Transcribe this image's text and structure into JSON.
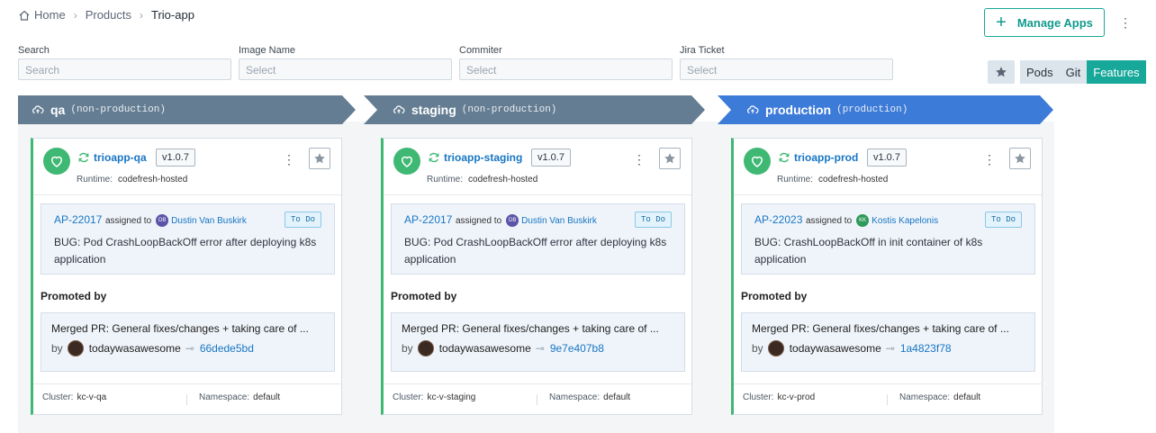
{
  "breadcrumb": {
    "home": "Home",
    "products": "Products",
    "current": "Trio-app"
  },
  "actions": {
    "manage_apps": "Manage Apps"
  },
  "filters": [
    {
      "label": "Search",
      "placeholder": "Search"
    },
    {
      "label": "Image Name",
      "placeholder": "Select"
    },
    {
      "label": "Commiter",
      "placeholder": "Select"
    },
    {
      "label": "Jira Ticket",
      "placeholder": "Select"
    }
  ],
  "view_toggle": {
    "pods": "Pods",
    "git": "Git",
    "features": "Features",
    "active": "Features"
  },
  "colors": {
    "accent": "#17a89a",
    "env_default": "#647d92",
    "env_production": "#3d7bd8",
    "health": "#3fb874",
    "link": "#1876c4"
  },
  "environments": [
    {
      "name": "qa",
      "type": "(non-production)",
      "app": "trioapp-qa",
      "version": "v1.0.7",
      "runtime_label": "Runtime:",
      "runtime": "codefresh-hosted",
      "jira": {
        "id": "AP-22017",
        "assigned_label": "assigned to",
        "initials": "DB",
        "assignee": "Dustin Van Buskirk",
        "status": "To Do",
        "title": "BUG: Pod CrashLoopBackOff error after deploying k8s application"
      },
      "promoted_label": "Promoted by",
      "pr": {
        "title": "Merged PR: General fixes/changes + taking care of ...",
        "by": "by",
        "user": "todaywasawesome",
        "sha": "66dede5bd"
      },
      "cluster_label": "Cluster:",
      "cluster": "kc-v-qa",
      "namespace_label": "Namespace:",
      "namespace": "default"
    },
    {
      "name": "staging",
      "type": "(non-production)",
      "app": "trioapp-staging",
      "version": "v1.0.7",
      "runtime_label": "Runtime:",
      "runtime": "codefresh-hosted",
      "jira": {
        "id": "AP-22017",
        "assigned_label": "assigned to",
        "initials": "DB",
        "assignee": "Dustin Van Buskirk",
        "status": "To Do",
        "title": "BUG: Pod CrashLoopBackOff error after deploying k8s application"
      },
      "promoted_label": "Promoted by",
      "pr": {
        "title": "Merged PR: General fixes/changes + taking care of ...",
        "by": "by",
        "user": "todaywasawesome",
        "sha": "9e7e407b8"
      },
      "cluster_label": "Cluster:",
      "cluster": "kc-v-staging",
      "namespace_label": "Namespace:",
      "namespace": "default"
    },
    {
      "name": "production",
      "type": "(production)",
      "app": "trioapp-prod",
      "version": "v1.0.7",
      "runtime_label": "Runtime:",
      "runtime": "codefresh-hosted",
      "jira": {
        "id": "AP-22023",
        "assigned_label": "assigned to",
        "initials": "KK",
        "assignee": "Kostis Kapelonis",
        "status": "To Do",
        "title": "BUG: CrashLoopBackOff in init container of k8s application"
      },
      "promoted_label": "Promoted by",
      "pr": {
        "title": "Merged PR: General fixes/changes + taking care of ...",
        "by": "by",
        "user": "todaywasawesome",
        "sha": "1a4823f78"
      },
      "cluster_label": "Cluster:",
      "cluster": "kc-v-prod",
      "namespace_label": "Namespace:",
      "namespace": "default"
    }
  ]
}
